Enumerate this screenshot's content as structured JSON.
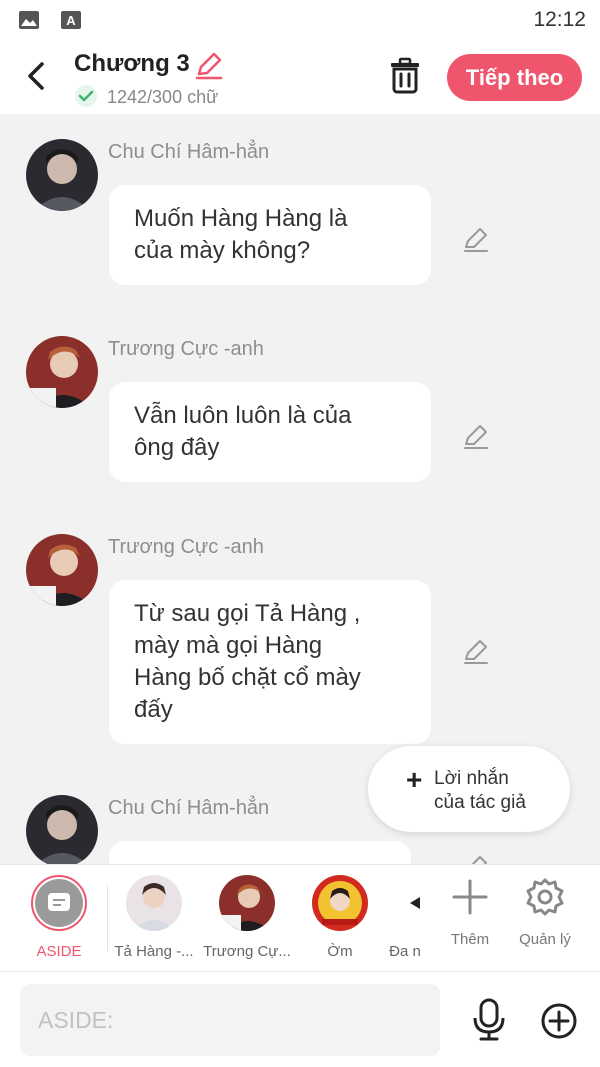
{
  "status_bar": {
    "time": "12:12",
    "icons": [
      "image-icon",
      "text-a-icon"
    ]
  },
  "header": {
    "title": "Chương 3",
    "word_count": "1242/300 chữ",
    "next_label": "Tiếp theo",
    "accent": "#f0556e"
  },
  "messages": [
    {
      "sender": "Chu Chí Hâm-hẳn",
      "lines": [
        "Muốn Hàng Hàng là",
        "của mày không?"
      ]
    },
    {
      "sender": "Trương Cực -anh",
      "lines": [
        "Vẫn luôn luôn là của",
        "ông đây"
      ]
    },
    {
      "sender": "Trương Cực -anh",
      "lines": [
        "Từ sau gọi Tả Hàng ,",
        "mày mà gọi Hàng",
        "Hàng bố chặt cổ mày",
        "đấy"
      ]
    },
    {
      "sender": "Chu Chí Hâm-hẳn",
      "lines": []
    }
  ],
  "author_note": {
    "line1": "Lời nhắn",
    "line2": "của tác giả"
  },
  "characters": [
    {
      "name": "ASIDE",
      "selected": true
    },
    {
      "name": "Tả Hàng -..."
    },
    {
      "name": "Trương Cự..."
    },
    {
      "name": "Ờm"
    },
    {
      "name": "Đa n"
    }
  ],
  "tools": {
    "add_label": "Thêm",
    "manage_label": "Quản lý"
  },
  "composer": {
    "placeholder": "ASIDE:"
  }
}
